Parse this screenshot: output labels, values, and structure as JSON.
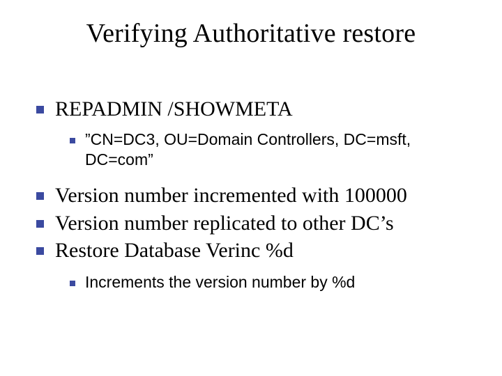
{
  "title": "Verifying Authoritative restore",
  "bullets": {
    "item1": {
      "text": "REPADMIN /SHOWMETA",
      "sub1": "”CN=DC3, OU=Domain Controllers, DC=msft, DC=com”"
    },
    "item2": "Version number incremented with 100000",
    "item3": "Version number replicated to other DC’s",
    "item4": {
      "text": "Restore Database Verinc %d",
      "sub1": "Increments the version number by %d"
    }
  },
  "colors": {
    "bullet": "#3b4aa0",
    "text": "#000000",
    "background": "#ffffff"
  }
}
